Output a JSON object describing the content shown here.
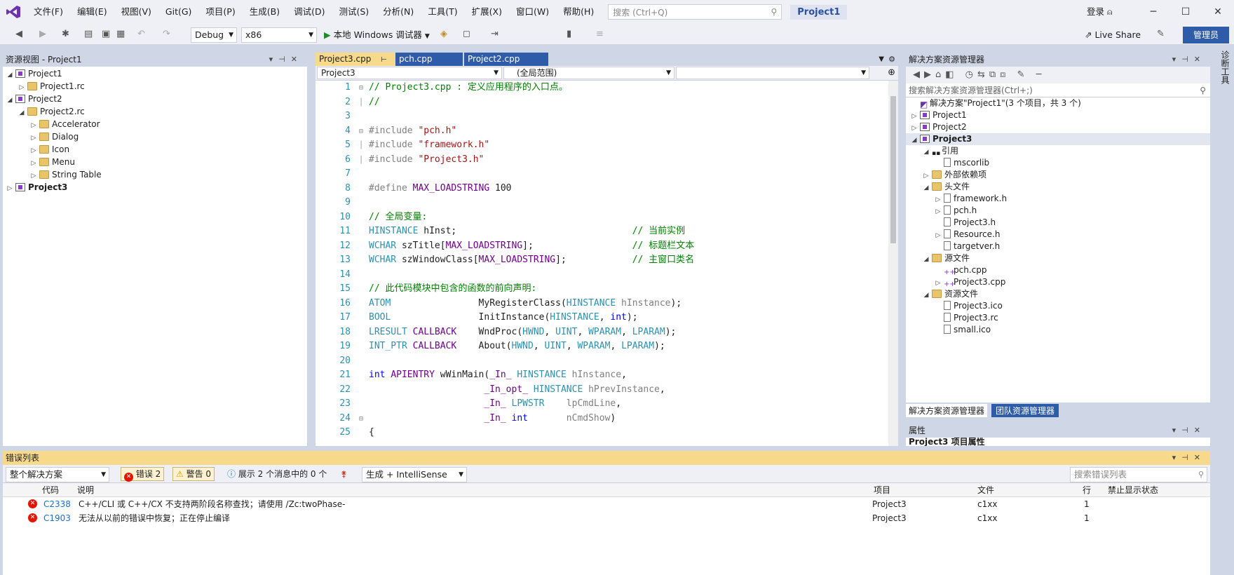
{
  "menubar": {
    "items": [
      "文件(F)",
      "编辑(E)",
      "视图(V)",
      "Git(G)",
      "项目(P)",
      "生成(B)",
      "调试(D)",
      "测试(S)",
      "分析(N)",
      "工具(T)",
      "扩展(X)",
      "窗口(W)",
      "帮助(H)"
    ],
    "search_placeholder": "搜索 (Ctrl+Q)",
    "project_name": "Project1",
    "login": "登录"
  },
  "toolbar": {
    "config": "Debug",
    "platform": "x86",
    "run_label": "本地 Windows 调试器",
    "live_share": "Live Share",
    "admin": "管理员"
  },
  "resource_view": {
    "title": "资源视图 - Project1",
    "tree": [
      {
        "label": "Project1",
        "level": 0,
        "expanded": true,
        "bold": false,
        "icon": "project"
      },
      {
        "label": "Project1.rc",
        "level": 1,
        "expanded": false,
        "bold": false,
        "icon": "folder"
      },
      {
        "label": "Project2",
        "level": 0,
        "expanded": true,
        "bold": false,
        "icon": "project"
      },
      {
        "label": "Project2.rc",
        "level": 1,
        "expanded": true,
        "bold": false,
        "icon": "folder"
      },
      {
        "label": "Accelerator",
        "level": 2,
        "expanded": false,
        "bold": false,
        "icon": "folder"
      },
      {
        "label": "Dialog",
        "level": 2,
        "expanded": false,
        "bold": false,
        "icon": "folder"
      },
      {
        "label": "Icon",
        "level": 2,
        "expanded": false,
        "bold": false,
        "icon": "folder"
      },
      {
        "label": "Menu",
        "level": 2,
        "expanded": false,
        "bold": false,
        "icon": "folder"
      },
      {
        "label": "String Table",
        "level": 2,
        "expanded": false,
        "bold": false,
        "icon": "folder"
      },
      {
        "label": "Project3",
        "level": 0,
        "expanded": false,
        "bold": true,
        "icon": "project"
      }
    ]
  },
  "editor": {
    "tabs": [
      "Project3.cpp",
      "pch.cpp",
      "Project2.cpp"
    ],
    "nav_project": "Project3",
    "nav_scope": "(全局范围)",
    "lines": [
      "1",
      "2",
      "3",
      "4",
      "5",
      "6",
      "7",
      "8",
      "9",
      "10",
      "11",
      "12",
      "13",
      "14",
      "15",
      "16",
      "17",
      "18",
      "19",
      "20",
      "21",
      "22",
      "23",
      "24",
      "25"
    ]
  },
  "solution_explorer": {
    "title": "解决方案资源管理器",
    "search_placeholder": "搜索解决方案资源管理器(Ctrl+;)",
    "tree": [
      {
        "label": "解决方案\"Project1\"(3 个项目，共 3 个)",
        "level": 0,
        "exp": "",
        "bold": false,
        "icon": "solution"
      },
      {
        "label": "Project1",
        "level": 0,
        "exp": "▷",
        "bold": false,
        "icon": "project"
      },
      {
        "label": "Project2",
        "level": 0,
        "exp": "▷",
        "bold": false,
        "icon": "project"
      },
      {
        "label": "Project3",
        "level": 0,
        "exp": "◢",
        "bold": true,
        "icon": "project"
      },
      {
        "label": "引用",
        "level": 1,
        "exp": "◢",
        "bold": false,
        "icon": "ref"
      },
      {
        "label": "mscorlib",
        "level": 2,
        "exp": "",
        "bold": false,
        "icon": "file"
      },
      {
        "label": "外部依赖项",
        "level": 1,
        "exp": "▷",
        "bold": false,
        "icon": "folder"
      },
      {
        "label": "头文件",
        "level": 1,
        "exp": "◢",
        "bold": false,
        "icon": "folder"
      },
      {
        "label": "framework.h",
        "level": 2,
        "exp": "▷",
        "bold": false,
        "icon": "file"
      },
      {
        "label": "pch.h",
        "level": 2,
        "exp": "▷",
        "bold": false,
        "icon": "file"
      },
      {
        "label": "Project3.h",
        "level": 2,
        "exp": "",
        "bold": false,
        "icon": "file"
      },
      {
        "label": "Resource.h",
        "level": 2,
        "exp": "▷",
        "bold": false,
        "icon": "file"
      },
      {
        "label": "targetver.h",
        "level": 2,
        "exp": "",
        "bold": false,
        "icon": "file"
      },
      {
        "label": "源文件",
        "level": 1,
        "exp": "◢",
        "bold": false,
        "icon": "folder"
      },
      {
        "label": "pch.cpp",
        "level": 2,
        "exp": "",
        "bold": false,
        "icon": "cpp"
      },
      {
        "label": "Project3.cpp",
        "level": 2,
        "exp": "▷",
        "bold": false,
        "icon": "cpp"
      },
      {
        "label": "资源文件",
        "level": 1,
        "exp": "◢",
        "bold": false,
        "icon": "folder"
      },
      {
        "label": "Project3.ico",
        "level": 2,
        "exp": "",
        "bold": false,
        "icon": "image"
      },
      {
        "label": "Project3.rc",
        "level": 2,
        "exp": "",
        "bold": false,
        "icon": "file"
      },
      {
        "label": "small.ico",
        "level": 2,
        "exp": "",
        "bold": false,
        "icon": "image"
      }
    ],
    "tab_active": "解决方案资源管理器",
    "tab_other": "团队资源管理器"
  },
  "properties": {
    "title": "属性",
    "subtitle": "Project3 项目属性"
  },
  "error_list": {
    "title": "错误列表",
    "scope": "整个解决方案",
    "errors_label": "错误 2",
    "warnings_label": "警告 0",
    "messages_label": "展示 2 个消息中的 0 个",
    "build_filter": "生成 + IntelliSense",
    "search_placeholder": "搜索错误列表",
    "columns": [
      "代码",
      "说明",
      "项目",
      "文件",
      "行",
      "禁止显示状态"
    ],
    "rows": [
      {
        "code": "C2338",
        "desc": "C++/CLI 或 C++/CX 不支持两阶段名称查找；请使用 /Zc:twoPhase-",
        "project": "Project3",
        "file": "c1xx",
        "line": "1",
        "suppress": ""
      },
      {
        "code": "C1903",
        "desc": "无法从以前的错误中恢复；正在停止编译",
        "project": "Project3",
        "file": "c1xx",
        "line": "1",
        "suppress": ""
      }
    ]
  },
  "right_strip": {
    "label": "诊断工具"
  },
  "colors": {
    "accent": "#2f5ca8",
    "active_panel": "#f6d98a",
    "error": "#e51400"
  }
}
